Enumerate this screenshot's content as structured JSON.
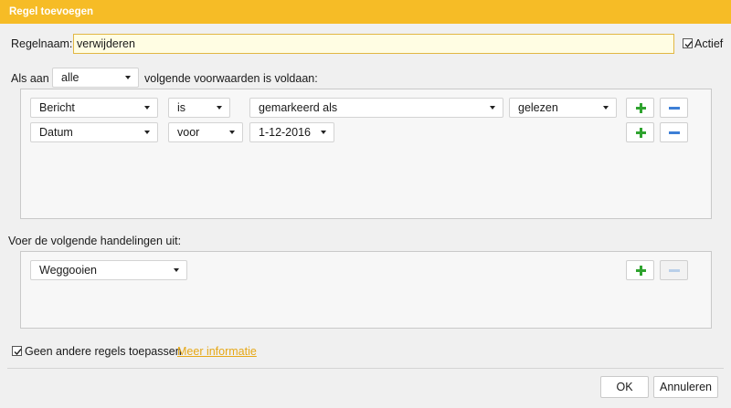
{
  "dialog": {
    "title": "Regel toevoegen"
  },
  "rule_name": {
    "label": "Regelnaam:",
    "value": "verwijderen"
  },
  "active": {
    "label": "Actief",
    "checked": true
  },
  "conditions_header": {
    "prefix": "Als aan",
    "match_value": "alle",
    "suffix": "volgende voorwaarden is voldaan:"
  },
  "conditions": [
    {
      "field": "Bericht",
      "operator": "is",
      "value": "gemarkeerd als",
      "extra": "gelezen"
    },
    {
      "field": "Datum",
      "operator": "voor",
      "value": "1-12-2016"
    }
  ],
  "actions_header": {
    "label": "Voer de volgende handelingen uit:"
  },
  "actions": [
    {
      "value": "Weggooien"
    }
  ],
  "footer": {
    "no_other_rules_label": "Geen andere regels toepassen",
    "no_other_rules_checked": true,
    "more_info_link": "Meer informatie",
    "ok_label": "OK",
    "cancel_label": "Annuleren"
  },
  "colors": {
    "title_bar": "#f6bc26",
    "link": "#e6a817",
    "plus_icon": "#2fa32f",
    "minus_icon": "#3d7fd6"
  }
}
